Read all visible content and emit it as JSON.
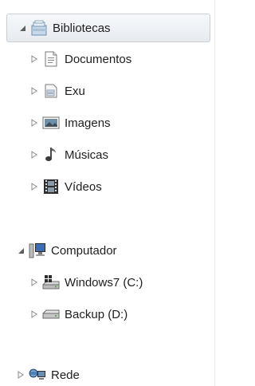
{
  "tree": {
    "libraries": {
      "label": "Bibliotecas",
      "expanded": true,
      "icon": "libraries-icon",
      "children": [
        {
          "label": "Documentos",
          "icon": "documents-icon"
        },
        {
          "label": "Exu",
          "icon": "library-folder-icon"
        },
        {
          "label": "Imagens",
          "icon": "pictures-icon"
        },
        {
          "label": "Músicas",
          "icon": "music-icon"
        },
        {
          "label": "Vídeos",
          "icon": "videos-icon"
        }
      ]
    },
    "computer": {
      "label": "Computador",
      "expanded": true,
      "icon": "computer-icon",
      "children": [
        {
          "label": "Windows7 (C:)",
          "icon": "system-drive-icon"
        },
        {
          "label": "Backup (D:)",
          "icon": "drive-icon"
        }
      ]
    },
    "network": {
      "label": "Rede",
      "expanded": false,
      "icon": "network-icon"
    }
  },
  "colors": {
    "selection_border": "#c8cdd3",
    "arrow": "#808080",
    "text": "#1e1e1e"
  }
}
